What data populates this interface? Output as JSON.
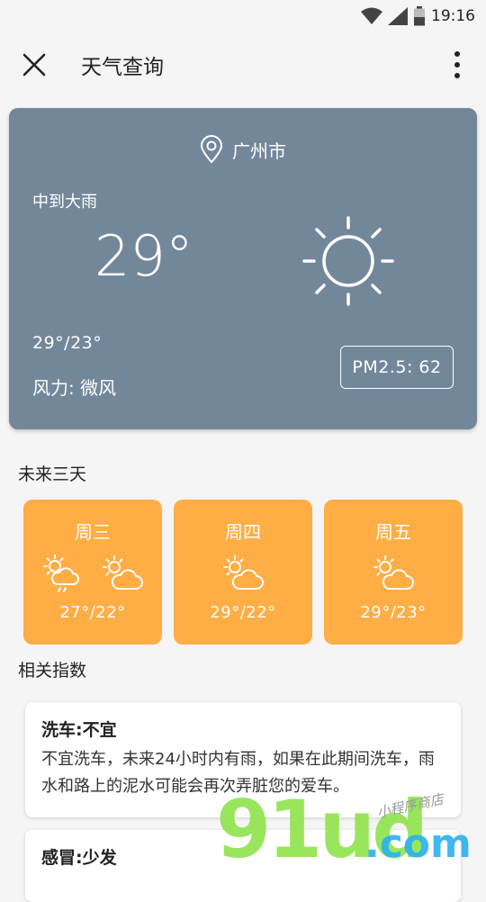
{
  "status": {
    "time": "19:16"
  },
  "app_bar": {
    "title": "天气查询",
    "close_icon": "close-icon",
    "more_icon": "more-vert-icon"
  },
  "current": {
    "city": "广州市",
    "condition": "中到大雨",
    "temperature": "29°",
    "range": "29°/23°",
    "wind": "风力: 微风",
    "pm25": "PM2.5: 62",
    "icon": "sun-icon",
    "card_color": "#73879b"
  },
  "forecast": {
    "title": "未来三天",
    "card_color": "#ffad45",
    "days": [
      {
        "name": "周三",
        "range": "27°/22°",
        "icons": [
          "partly-cloudy-rain-icon",
          "partly-cloudy-icon"
        ]
      },
      {
        "name": "周四",
        "range": "29°/22°",
        "icons": [
          "partly-cloudy-icon"
        ]
      },
      {
        "name": "周五",
        "range": "29°/23°",
        "icons": [
          "partly-cloudy-icon"
        ]
      }
    ]
  },
  "indices": {
    "title": "相关指数",
    "items": [
      {
        "title": "洗车:不宜",
        "desc": "不宜洗车，未来24小时内有雨，如果在此期间洗车，雨水和路上的泥水可能会再次弄脏您的爱车。"
      },
      {
        "title": "感冒:少发",
        "desc": ""
      }
    ]
  },
  "watermark": {
    "main": "91ud.com",
    "sub": "小程序商店"
  }
}
